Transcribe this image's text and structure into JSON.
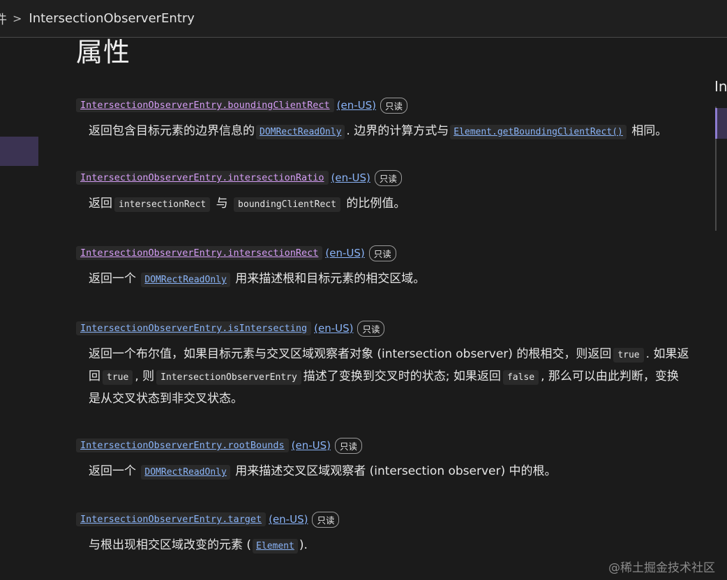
{
  "breadcrumb": {
    "prev": "件",
    "current": "IntersectionObserverEntry"
  },
  "toc": {
    "label": "In"
  },
  "section_title": "属性",
  "read_only_badge": "只读",
  "locale_label": "(en-US)",
  "properties": [
    {
      "name": "IntersectionObserverEntry.boundingClientRect",
      "d1": "返回包含目标元素的边界信息的",
      "c1": "DOMRectReadOnly",
      "d2": ". 边界的计算方式与",
      "c2": "Element.getBoundingClientRect()",
      "d3": " 相同。"
    },
    {
      "name": "IntersectionObserverEntry.intersectionRatio",
      "d1": "返回",
      "c1": "intersectionRect",
      "d2": " 与 ",
      "c2": "boundingClientRect",
      "d3": " 的比例值。"
    },
    {
      "name": "IntersectionObserverEntry.intersectionRect",
      "d1": "返回一个 ",
      "c1": "DOMRectReadOnly",
      "d2": " 用来描述根和目标元素的相交区域。"
    },
    {
      "name": "IntersectionObserverEntry.isIntersecting",
      "d1": "返回一个布尔值，如果目标元素与交叉区域观察者对象 (intersection observer) 的根相交，则返回",
      "c1": "true",
      "d2": ". 如果返回",
      "c2": "true",
      "d3": ", 则",
      "c3": "IntersectionObserverEntry",
      "d4": "描述了变换到交叉时的状态; 如果返回",
      "c4": "false",
      "d5": ", 那么可以由此判断，变换是从交叉状态到非交叉状态。"
    },
    {
      "name": "IntersectionObserverEntry.rootBounds",
      "d1": "返回一个 ",
      "c1": "DOMRectReadOnly",
      "d2": " 用来描述交叉区域观察者 (intersection observer) 中的根。"
    },
    {
      "name": "IntersectionObserverEntry.target",
      "d1": "与根出现相交区域改变的元素 (",
      "c1": "Element",
      "d2": ")."
    }
  ],
  "watermark": "@稀土掘金技术社区"
}
